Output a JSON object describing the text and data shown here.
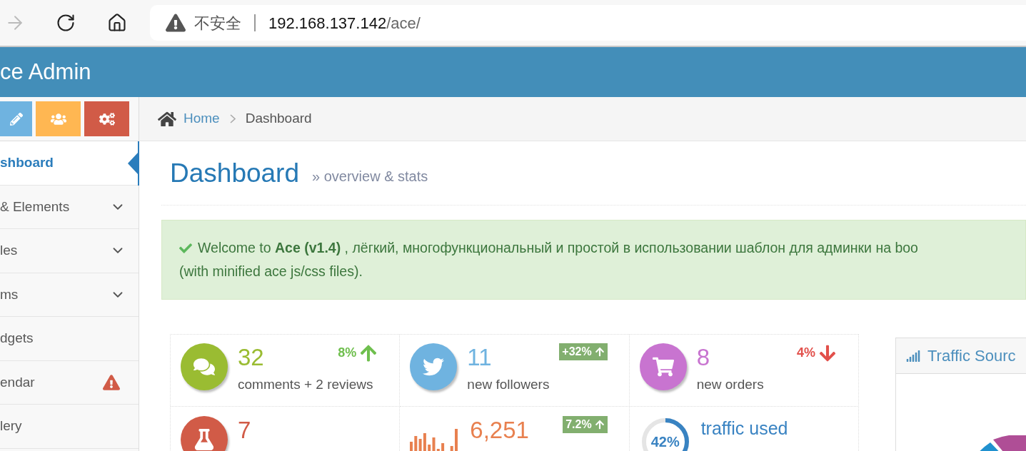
{
  "browser": {
    "security": "不安全",
    "url_host": "192.168.137.142",
    "url_path": "/ace/"
  },
  "header": {
    "brand": "ce Admin"
  },
  "sidebar": {
    "items": [
      {
        "label": "shboard",
        "selected": true,
        "kind": "plain"
      },
      {
        "label": "& Elements",
        "selected": false,
        "kind": "submenu"
      },
      {
        "label": "les",
        "selected": false,
        "kind": "submenu"
      },
      {
        "label": "ms",
        "selected": false,
        "kind": "submenu"
      },
      {
        "label": "dgets",
        "selected": false,
        "kind": "plain"
      },
      {
        "label": "endar",
        "selected": false,
        "kind": "alert"
      },
      {
        "label": "lery",
        "selected": false,
        "kind": "plain"
      }
    ]
  },
  "breadcrumb": {
    "home": "Home",
    "current": "Dashboard"
  },
  "page_header": {
    "title": "Dashboard",
    "subtitle": "» overview & stats"
  },
  "alert": {
    "line1": "Welcome to **Ace** **(v1.4)** , лёгкий, многофункциональный и простой в использовании шаблон для админки на boo",
    "line2": "(with minified ace js/css files)."
  },
  "infoboxes": [
    {
      "kind": "comments",
      "value": "32",
      "label": "comments + 2 reviews",
      "trend": "8%",
      "rising": true,
      "boxed": false,
      "color": "#9abc32"
    },
    {
      "kind": "twitter",
      "value": "11",
      "label": "new followers",
      "trend": "+32%",
      "rising": true,
      "boxed": true,
      "color": "#6fb3e0"
    },
    {
      "kind": "cart",
      "value": "8",
      "label": "new orders",
      "trend": "4%",
      "rising": false,
      "boxed": false,
      "color": "#c874d0"
    },
    {
      "kind": "flask",
      "value": "7",
      "color": "#d15b47"
    },
    {
      "kind": "sparkline",
      "value": "6,251",
      "trend": "7.2%",
      "rising": true,
      "boxed": true,
      "color": "#e8804f"
    },
    {
      "kind": "ring",
      "value": "42%",
      "label": "traffic used",
      "color": "#3983c2"
    }
  ],
  "traffic_widget": {
    "title": "Traffic Sourc"
  }
}
